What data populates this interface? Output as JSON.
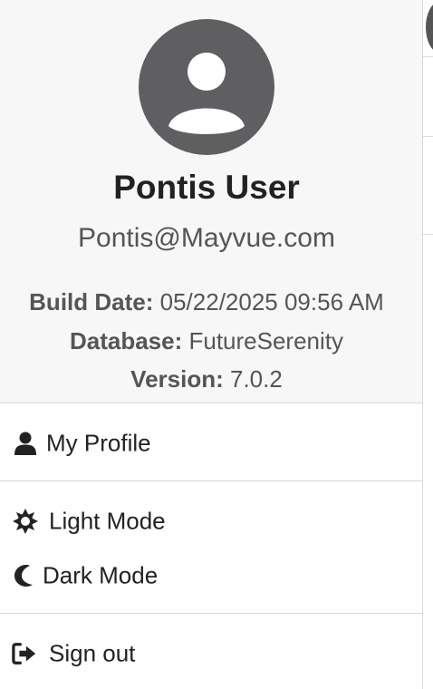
{
  "user": {
    "name": "Pontis User",
    "email": "Pontis@Mayvue.com"
  },
  "build_info": {
    "build_date_label": "Build Date:",
    "build_date_value": "05/22/2025 09:56 AM",
    "database_label": "Database:",
    "database_value": "FutureSerenity",
    "version_label": "Version:",
    "version_value": "7.0.2"
  },
  "menu": {
    "my_profile": "My Profile",
    "light_mode": "Light Mode",
    "dark_mode": "Dark Mode",
    "sign_out": "Sign out"
  },
  "icons": {
    "avatar": "user-circle-icon",
    "profile": "user-icon",
    "light": "sun-icon",
    "dark": "moon-icon",
    "signout": "sign-out-icon"
  },
  "colors": {
    "header_bg": "#f7f7f7",
    "avatar_fill": "#5f5f61",
    "text_primary": "#222222",
    "text_secondary": "#555555"
  }
}
